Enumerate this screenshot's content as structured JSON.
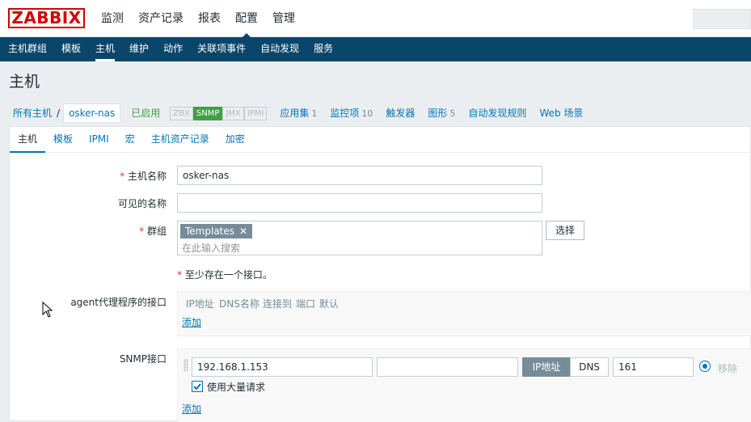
{
  "header": {
    "logo": "ZABBIX",
    "menu": [
      "监测",
      "资产记录",
      "报表",
      "配置",
      "管理"
    ],
    "active_menu": "配置"
  },
  "submenu": {
    "items": [
      "主机群组",
      "模板",
      "主机",
      "维护",
      "动作",
      "关联项事件",
      "自动发现",
      "服务"
    ],
    "active": "主机"
  },
  "page": {
    "title": "主机"
  },
  "host_nav": {
    "all_hosts": "所有主机",
    "separator": "/",
    "current_host": "osker-nas",
    "status": "已启用",
    "availability": [
      {
        "label": "ZBX",
        "active": false
      },
      {
        "label": "SNMP",
        "active": true
      },
      {
        "label": "JMX",
        "active": false
      },
      {
        "label": "IPMI",
        "active": false
      }
    ],
    "links": [
      {
        "label": "应用集",
        "count": "1"
      },
      {
        "label": "监控项",
        "count": "10"
      },
      {
        "label": "触发器",
        "count": ""
      },
      {
        "label": "图形",
        "count": "5"
      },
      {
        "label": "自动发现规则",
        "count": ""
      },
      {
        "label": "Web 场景",
        "count": ""
      }
    ]
  },
  "form": {
    "tabs": [
      "主机",
      "模板",
      "IPMI",
      "宏",
      "主机资产记录",
      "加密"
    ],
    "active_tab": "主机",
    "host_name_label": "主机名称",
    "host_name_value": "osker-nas",
    "visible_name_label": "可见的名称",
    "visible_name_value": "",
    "groups_label": "群组",
    "group_chip": "Templates",
    "group_placeholder": "在此输入搜索",
    "select_button": "选择",
    "interface_note": "至少存在一个接口。",
    "agent_label": "agent代理程序的接口",
    "columns": [
      "IP地址",
      "DNS名称",
      "连接到",
      "端口",
      "默认"
    ],
    "add_link": "添加",
    "snmp_label": "SNMP接口",
    "snmp": {
      "ip": "192.168.1.153",
      "dns": "",
      "connect_ip": "IP地址",
      "connect_dns": "DNS",
      "port": "161",
      "remove": "移除",
      "bulk_label": "使用大量请求",
      "bulk_checked": true
    }
  },
  "colors": {
    "brand": "#d40000",
    "nav_bg": "#0a466a",
    "link": "#0275b8",
    "enabled": "#429e47"
  }
}
